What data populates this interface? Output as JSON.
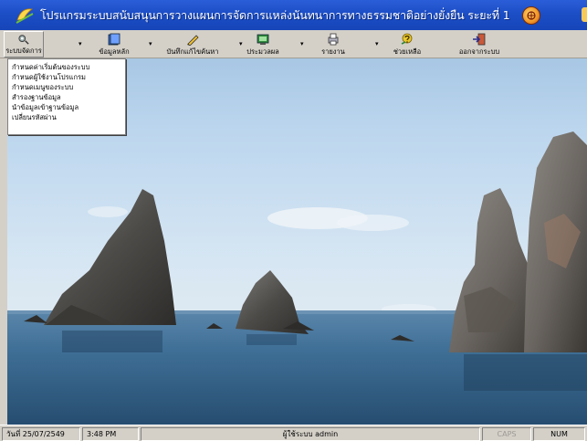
{
  "window": {
    "title": "โปรแกรมระบบสนับสนุนการวางแผนการจัดการแหล่งนันทนาการทางธรรมชาติอย่างยั่งยืน ระยะที่ 1"
  },
  "toolbar": {
    "items": [
      {
        "label": "ระบบจัดการ",
        "icon": "system-management-icon"
      },
      {
        "label": "ข้อมูลหลัก",
        "icon": "master-data-icon"
      },
      {
        "label": "บันทึกแก้ไขค้นหา",
        "icon": "record-edit-search-icon"
      },
      {
        "label": "ประมวลผล",
        "icon": "process-icon"
      },
      {
        "label": "รายงาน",
        "icon": "report-icon"
      },
      {
        "label": "ช่วยเหลือ",
        "icon": "help-icon"
      },
      {
        "label": "ออกจากระบบ",
        "icon": "exit-icon"
      }
    ]
  },
  "menu": {
    "items": [
      "กำหนดค่าเริ่มต้นของระบบ",
      "กำหนดผู้ใช้งานโปรแกรม",
      "กำหนดเมนูของระบบ",
      "สำรองฐานข้อมูล",
      "นำข้อมูลเข้าฐานข้อมูล",
      "เปลี่ยนรหัสผ่าน"
    ]
  },
  "statusbar": {
    "date": "วันที่ 25/07/2549",
    "time": "3:48 PM",
    "user": "ผู้ใช้ระบบ admin",
    "caps": "CAPS",
    "num": "NUM"
  },
  "colors": {
    "titlebar": "#1c4ec6",
    "chrome": "#d4d0c8",
    "sea": "#3f6f96"
  }
}
